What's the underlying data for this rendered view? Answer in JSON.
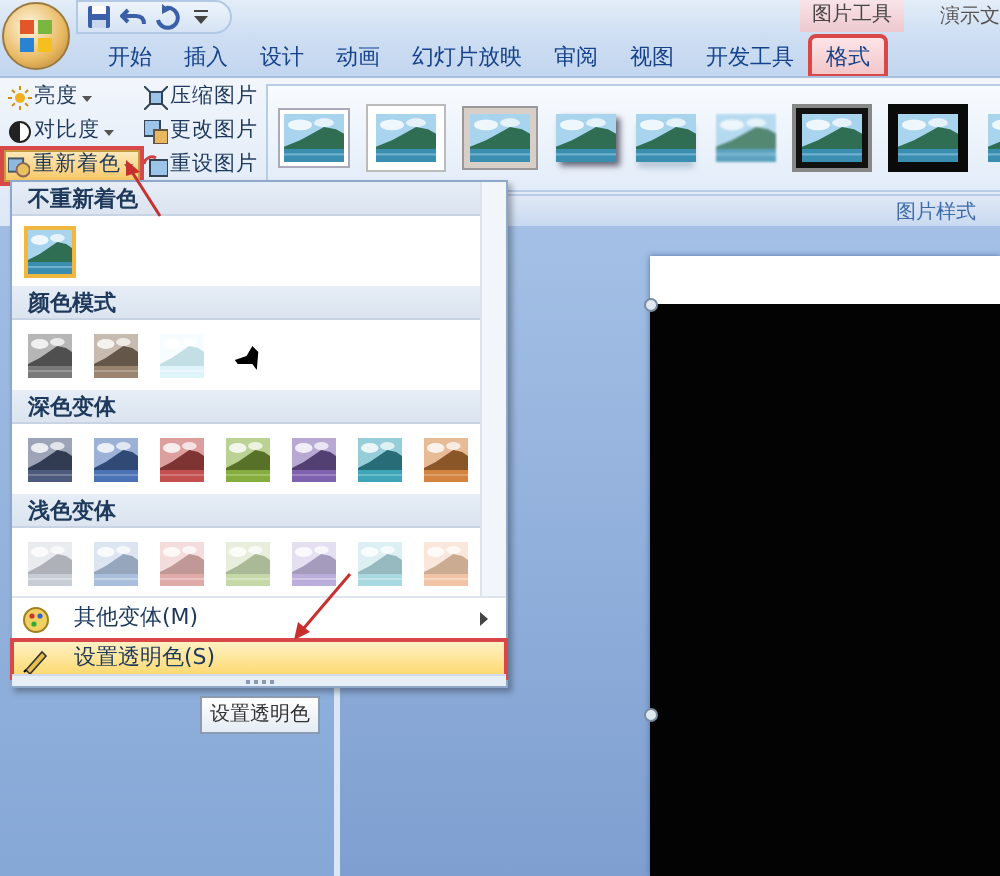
{
  "title_fragment": "演示文",
  "context_group": "图片工具",
  "tabs": [
    {
      "label": "开始",
      "selected": false,
      "marked": false
    },
    {
      "label": "插入",
      "selected": false,
      "marked": false
    },
    {
      "label": "设计",
      "selected": false,
      "marked": false
    },
    {
      "label": "动画",
      "selected": false,
      "marked": false
    },
    {
      "label": "幻灯片放映",
      "selected": false,
      "marked": false
    },
    {
      "label": "审阅",
      "selected": false,
      "marked": false
    },
    {
      "label": "视图",
      "selected": false,
      "marked": false
    },
    {
      "label": "开发工具",
      "selected": false,
      "marked": false
    },
    {
      "label": "格式",
      "selected": true,
      "marked": true
    }
  ],
  "ribbon": {
    "adjust_buttons": [
      {
        "kind": "brightness",
        "label": "亮度",
        "dropdown": true,
        "pressed": false,
        "marked": false
      },
      {
        "kind": "contrast",
        "label": "对比度",
        "dropdown": true,
        "pressed": false,
        "marked": false
      },
      {
        "kind": "recolor",
        "label": "重新着色",
        "dropdown": true,
        "pressed": true,
        "marked": true
      }
    ],
    "picture_buttons": [
      {
        "kind": "compress",
        "label": "压缩图片"
      },
      {
        "kind": "change",
        "label": "更改图片"
      },
      {
        "kind": "reset",
        "label": "重设图片"
      }
    ],
    "styles_gallery": [
      {
        "kind": "thin-frame"
      },
      {
        "kind": "white-frame"
      },
      {
        "kind": "gray-frame"
      },
      {
        "kind": "shadow"
      },
      {
        "kind": "reflection"
      },
      {
        "kind": "soft-edge"
      },
      {
        "kind": "black-frame"
      },
      {
        "kind": "black-matte"
      },
      {
        "kind": "plain"
      }
    ],
    "group_label": "图片样式"
  },
  "recolor_menu": {
    "sections": [
      {
        "heading": "不重新着色",
        "options": [
          {
            "kind": "original",
            "color": "#3a8fb0",
            "selected": true
          }
        ]
      },
      {
        "heading": "颜色模式",
        "options": [
          {
            "kind": "tint",
            "color": "#7a7a7a",
            "selected": false
          },
          {
            "kind": "tint",
            "color": "#9a8470",
            "selected": false
          },
          {
            "kind": "washout",
            "color": "#dff3fa",
            "selected": false
          },
          {
            "kind": "silhouette",
            "color": "#000000",
            "selected": false
          }
        ]
      },
      {
        "heading": "深色变体",
        "options": [
          {
            "kind": "tint",
            "color": "#4c5a7e",
            "selected": false
          },
          {
            "kind": "tint",
            "color": "#4a72b4",
            "selected": false
          },
          {
            "kind": "tint",
            "color": "#c2504e",
            "selected": false
          },
          {
            "kind": "tint",
            "color": "#86ae3e",
            "selected": false
          },
          {
            "kind": "tint",
            "color": "#7e62b0",
            "selected": false
          },
          {
            "kind": "tint",
            "color": "#3ea6b8",
            "selected": false
          },
          {
            "kind": "tint",
            "color": "#d4843e",
            "selected": false
          }
        ]
      },
      {
        "heading": "浅色变体",
        "options": [
          {
            "kind": "light",
            "color": "#c8ccd4",
            "selected": false
          },
          {
            "kind": "light",
            "color": "#a8bedc",
            "selected": false
          },
          {
            "kind": "light",
            "color": "#e0aaa8",
            "selected": false
          },
          {
            "kind": "light",
            "color": "#c4d8a8",
            "selected": false
          },
          {
            "kind": "light",
            "color": "#bcaedc",
            "selected": false
          },
          {
            "kind": "light",
            "color": "#a8d8e0",
            "selected": false
          },
          {
            "kind": "light",
            "color": "#f0c4a4",
            "selected": false
          }
        ]
      }
    ],
    "commands": [
      {
        "kind": "variants",
        "label": "其他变体(M)",
        "submenu": true,
        "hovered": false,
        "marked": false
      },
      {
        "kind": "transparent",
        "label": "设置透明色(S)",
        "submenu": false,
        "hovered": true,
        "marked": true
      }
    ]
  },
  "tooltip": "设置透明色"
}
